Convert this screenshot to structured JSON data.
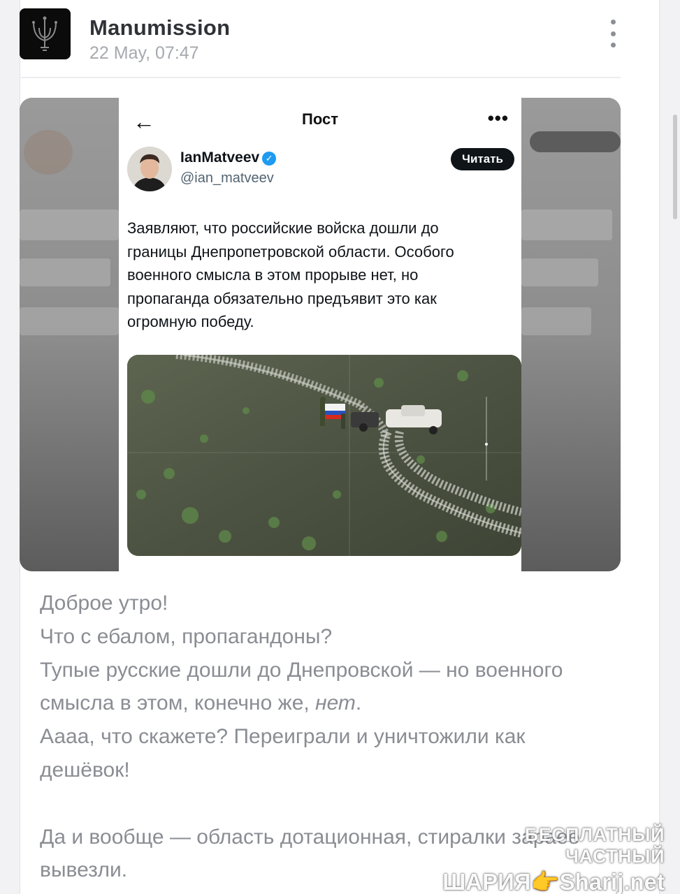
{
  "channel": {
    "name": "Manumission",
    "date": "22 May, 07:47"
  },
  "screenshot": {
    "nav_title": "Пост",
    "back_icon": "←",
    "more_icon": "•••",
    "author_name": "IanMatveev",
    "author_handle": "@ian_matveev",
    "verified_icon": "✓",
    "follow_label": "Читать",
    "tweet_lines": [
      "Заявляют, что российские войска дошли до",
      "границы Днепропетровской области. Особого",
      "военного смысла в этом прорыве нет, но",
      "пропаганда обязательно предъявит это как",
      "огромную победу."
    ]
  },
  "post_body": {
    "line1": "Доброе утро!",
    "line2": "Что с ебалом, пропагандоны?",
    "line3": "Тупые русские дошли до Днепровской — но военного",
    "line4_before": "смысла в этом, конечно же, ",
    "line4_italic": "нет",
    "line4_after": ".",
    "line5": "Аааа, что скажете? Переиграли и уничтожили как",
    "line6": "дешёвок!",
    "line7": "",
    "line8": "Да и вообще — область дотационная, стиралки зараее",
    "line9": "вывезли."
  },
  "watermark": {
    "line1": "БЕСПЛАТНЫЙ ЧАСТНЫЙ",
    "line2": "ШАРИЯ👉Sharij.net"
  },
  "colors": {
    "verified": "#1d9bf0",
    "body_text": "#8a8d93",
    "channel_name": "#2f3237"
  }
}
